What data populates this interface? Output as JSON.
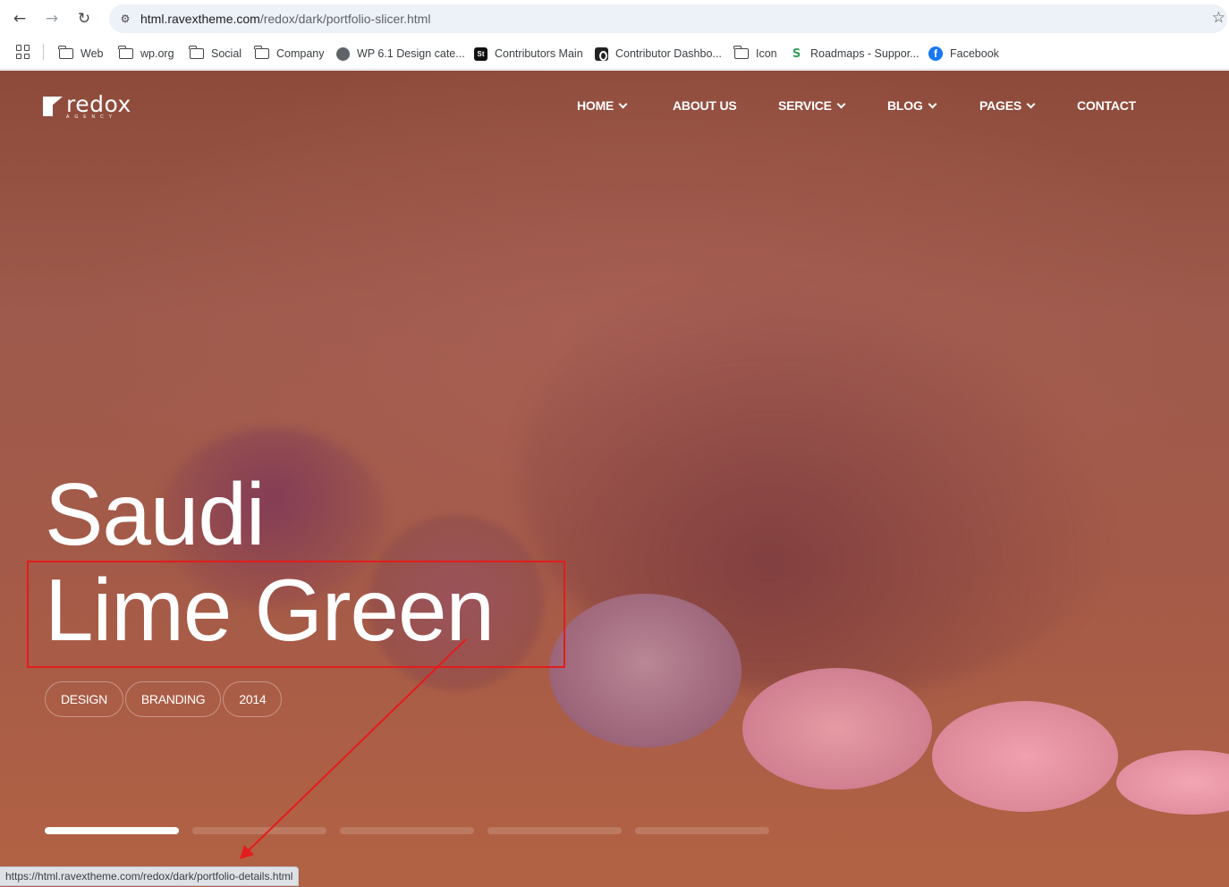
{
  "browser": {
    "url_host": "html.ravextheme.com",
    "url_path": "/redox/dark/portfolio-slicer.html",
    "bookmarks": [
      {
        "label": "Web",
        "icon": "folder-icon"
      },
      {
        "label": "wp.org",
        "icon": "folder-icon"
      },
      {
        "label": "Social",
        "icon": "folder-icon"
      },
      {
        "label": "Company",
        "icon": "folder-icon"
      },
      {
        "label": "WP 6.1 Design cate...",
        "icon": "globe-icon"
      },
      {
        "label": "Contributors Main",
        "icon": "st-icon"
      },
      {
        "label": "Contributor Dashbo...",
        "icon": "contributor-icon"
      },
      {
        "label": "Icon",
        "icon": "folder-icon"
      },
      {
        "label": "Roadmaps - Suppor...",
        "icon": "roadmap-icon"
      },
      {
        "label": "Facebook",
        "icon": "facebook-icon"
      }
    ],
    "status_url": "https://html.ravextheme.com/redox/dark/portfolio-details.html"
  },
  "site": {
    "logo_word": "redox",
    "logo_sub": "AGENCY",
    "nav": [
      {
        "label": "HOME",
        "dropdown": true
      },
      {
        "label": "ABOUT US",
        "dropdown": false
      },
      {
        "label": "SERVICE",
        "dropdown": true
      },
      {
        "label": "BLOG",
        "dropdown": true
      },
      {
        "label": "PAGES",
        "dropdown": true
      },
      {
        "label": "CONTACT",
        "dropdown": false
      }
    ]
  },
  "hero": {
    "title_line1": "Saudi",
    "title_line2": "Lime Green",
    "tags": [
      "DESIGN",
      "BRANDING",
      "2014"
    ],
    "slides_total": 5,
    "active_slide": 1
  },
  "colors": {
    "highlight": "#e31c1c",
    "text": "#ffffff"
  }
}
